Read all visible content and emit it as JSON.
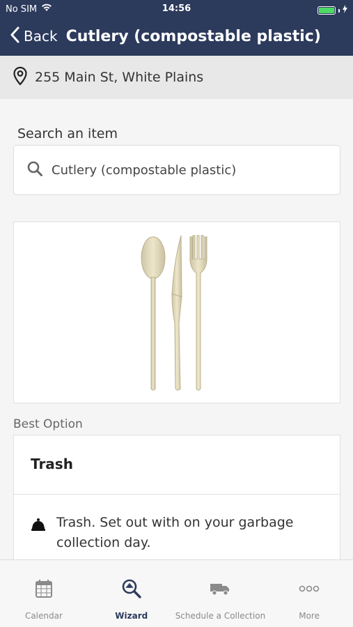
{
  "status_bar": {
    "carrier": "No SIM",
    "time": "14:56",
    "battery_level": 1.0
  },
  "nav": {
    "back_label": "Back",
    "title": "Cutlery (compostable plastic)"
  },
  "address": {
    "text": "255 Main St, White Plains"
  },
  "search": {
    "label": "Search an item",
    "value": "Cutlery (compostable plastic)"
  },
  "item_image": {
    "icon": "cutlery-image"
  },
  "best_option": {
    "label": "Best Option",
    "title": "Trash",
    "description": "Trash. Set out with on your garbage collection day."
  },
  "tabs": [
    {
      "label": "Calendar",
      "icon": "calendar-icon",
      "active": false
    },
    {
      "label": "Wizard",
      "icon": "wizard-search-icon",
      "active": true
    },
    {
      "label": "Schedule a Collection",
      "icon": "truck-icon",
      "active": false
    },
    {
      "label": "More",
      "icon": "more-icon",
      "active": false
    }
  ],
  "colors": {
    "header": "#2c3a5c",
    "battery": "#4cd964",
    "tab_active": "#2c3a5c"
  }
}
